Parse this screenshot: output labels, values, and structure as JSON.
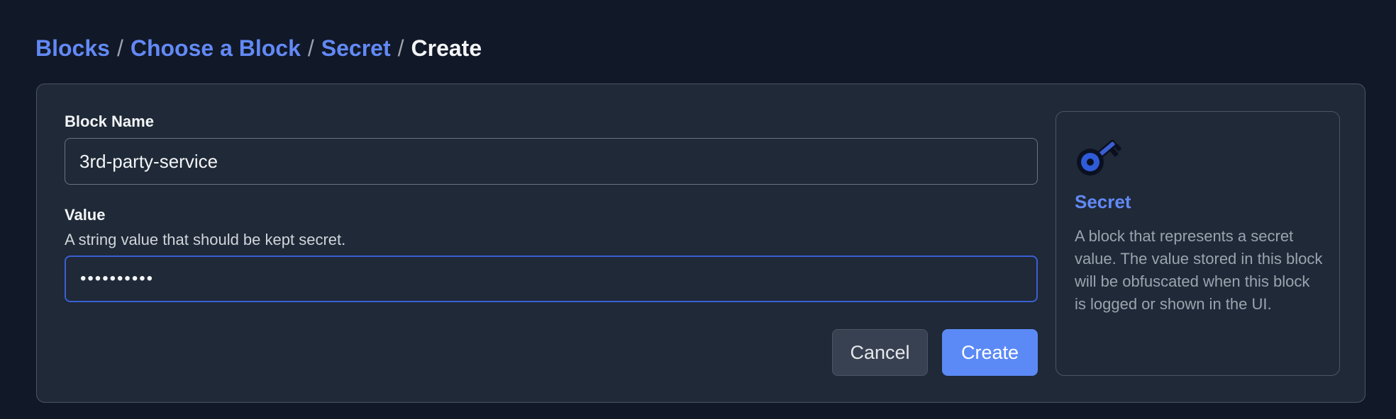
{
  "breadcrumb": {
    "items": [
      "Blocks",
      "Choose a Block",
      "Secret"
    ],
    "separator": "/",
    "current": "Create"
  },
  "form": {
    "block_name": {
      "label": "Block Name",
      "value": "3rd-party-service"
    },
    "value": {
      "label": "Value",
      "description": "A string value that should be kept secret.",
      "masked_value": "••••••••••"
    },
    "cancel_label": "Cancel",
    "create_label": "Create"
  },
  "info": {
    "icon": "key-icon",
    "title": "Secret",
    "description": "A block that represents a secret value. The value stored in this block will be obfuscated when this block is logged or shown in the UI."
  },
  "colors": {
    "background": "#111827",
    "card": "#1f2937",
    "accent": "#5b8af6",
    "link": "#6289f5",
    "focus_border": "#3b5fd4"
  }
}
